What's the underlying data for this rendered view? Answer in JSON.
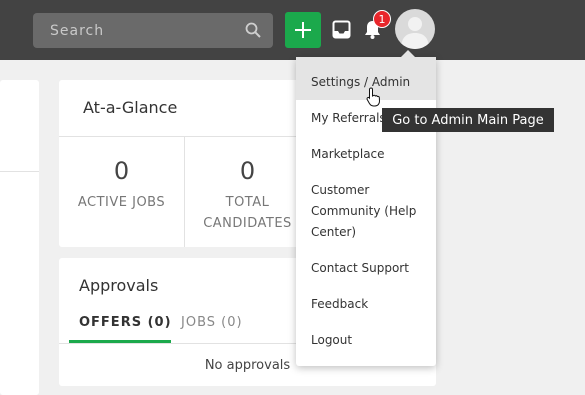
{
  "header": {
    "search": {
      "placeholder": "Search",
      "icon": "search-icon"
    },
    "notifications": {
      "count": "1"
    },
    "colors": {
      "topbar": "#434343",
      "add_button": "#1ba94c",
      "badge": "#e8262b"
    }
  },
  "glance": {
    "title": "At-a-Glance",
    "stats": [
      {
        "value": "0",
        "label": "ACTIVE JOBS"
      },
      {
        "value": "0",
        "label": "TOTAL",
        "label2": "CANDIDATES"
      }
    ]
  },
  "approvals": {
    "title": "Approvals",
    "tabs": [
      {
        "label": "OFFERS (0)",
        "active": true
      },
      {
        "label": "JOBS (0)",
        "active": false
      }
    ],
    "empty_text": "No approvals"
  },
  "menu": {
    "items": [
      {
        "label": "Settings / Admin"
      },
      {
        "label": "My Referrals"
      },
      {
        "label": "Marketplace"
      },
      {
        "lines": [
          "Customer",
          "Community (Help",
          "Center)"
        ]
      },
      {
        "label": "Contact Support"
      },
      {
        "label": "Feedback"
      },
      {
        "label": "Logout"
      }
    ]
  },
  "tooltip": {
    "text": "Go to Admin Main Page"
  }
}
